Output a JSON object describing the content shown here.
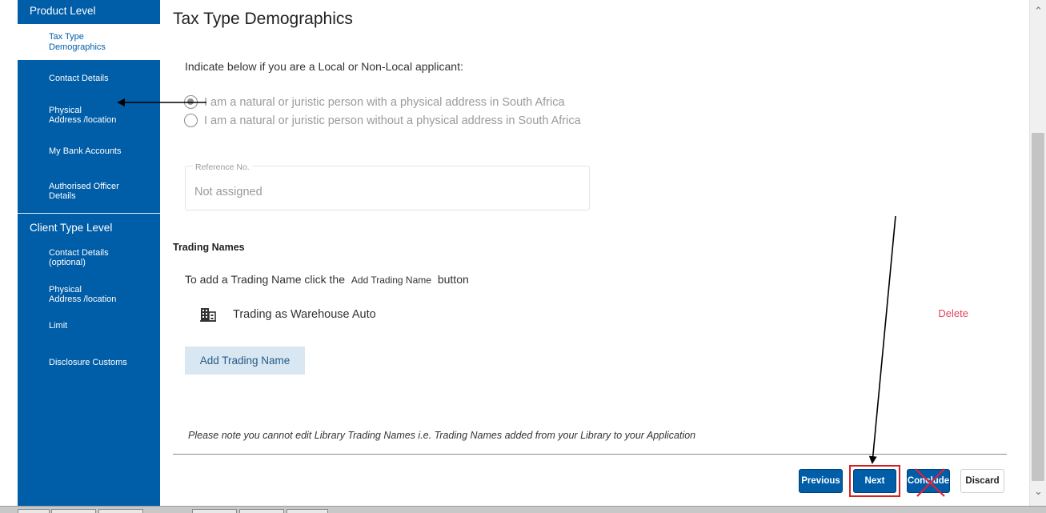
{
  "sidebar": {
    "product_level_title": "Product Level",
    "product_items": [
      {
        "line1": "Tax Type",
        "line2": "Demographics"
      },
      {
        "line1": "Contact Details",
        "line2": ""
      },
      {
        "line1": "Physical",
        "line2": "Address /location"
      },
      {
        "line1": "My Bank Accounts",
        "line2": ""
      },
      {
        "line1": "Authorised Officer",
        "line2": "Details"
      }
    ],
    "client_level_title": "Client Type Level",
    "client_items": [
      {
        "line1": "Contact Details",
        "line2": "(optional)"
      },
      {
        "line1": "Physical",
        "line2": "Address /location"
      },
      {
        "line1": "Limit",
        "line2": ""
      },
      {
        "line1": "Disclosure Customs",
        "line2": ""
      }
    ]
  },
  "main": {
    "title": "Tax Type Demographics",
    "instruction": "Indicate below if you are a Local or Non-Local applicant:",
    "radio_local": "I am a natural or juristic person with a physical address in South Africa",
    "radio_nonlocal": "I am a natural or juristic person without a physical address in South Africa",
    "reference": {
      "label": "Reference No.",
      "value": "Not assigned"
    },
    "trading": {
      "section_title": "Trading Names",
      "instr_before": "To add a Trading Name click the",
      "instr_button": "Add Trading Name",
      "instr_after": "button",
      "entry_name": "Trading as Warehouse Auto",
      "delete_label": "Delete",
      "add_button": "Add Trading Name"
    },
    "note": "Please note  you cannot edit Library Trading Names i.e. Trading Names added from your Library to your Application"
  },
  "footer": {
    "previous_label": "Previous",
    "next_label": "Next",
    "conclude_label": "Conclude",
    "discard_label": "Discard"
  },
  "colors": {
    "sidebar_bg": "#005da8",
    "primary_button": "#005da8",
    "delete_link": "#e0455c",
    "highlight_box": "#d62020"
  },
  "icons": {
    "trading_entry": "building-icon",
    "scroll_up": "scroll-up-icon",
    "scroll_down": "scroll-down-icon"
  }
}
